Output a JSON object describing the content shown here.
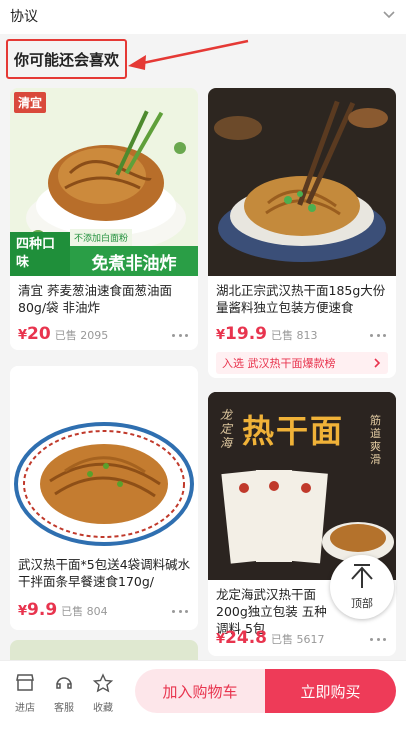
{
  "header": {
    "protocol_label": "协议"
  },
  "section": {
    "title": "你可能还会喜欢"
  },
  "products": [
    {
      "brand_badge": "清宜",
      "promo_left": "四种口味",
      "promo_tag": "不添加白面粉",
      "promo_right": "免煮非油炸",
      "title": "清宜 荞麦葱油速食面葱油面80g/袋 非油炸",
      "currency": "¥",
      "price": "20",
      "sold": "已售 2095"
    },
    {
      "title": "湖北正宗武汉热干面185g大份量酱料独立包装方便速食",
      "currency": "¥",
      "price": "19.9",
      "sold": "已售 813",
      "rank_label": "入选 武汉热干面爆款榜"
    },
    {
      "title": "武汉热干面*5包送4袋调料碱水干拌面条早餐速食170g/",
      "currency": "¥",
      "price": "9.9",
      "sold": "已售 804"
    },
    {
      "poster_brand": "龙定海",
      "poster_title": "热干面",
      "poster_side": "筋道爽滑",
      "title": "龙定海武汉热干面200g独立包装 五种调料 5包",
      "currency": "¥",
      "price": "24.8",
      "sold": "已售 5617"
    }
  ],
  "to_top": {
    "label": "顶部"
  },
  "bottom_bar": {
    "store": "进店",
    "service": "客服",
    "favorite": "收藏",
    "add_to_cart": "加入购物车",
    "buy_now": "立即购买"
  },
  "colors": {
    "accent": "#ee3b58",
    "price": "#e8344e",
    "highlight_box": "#e53935"
  }
}
